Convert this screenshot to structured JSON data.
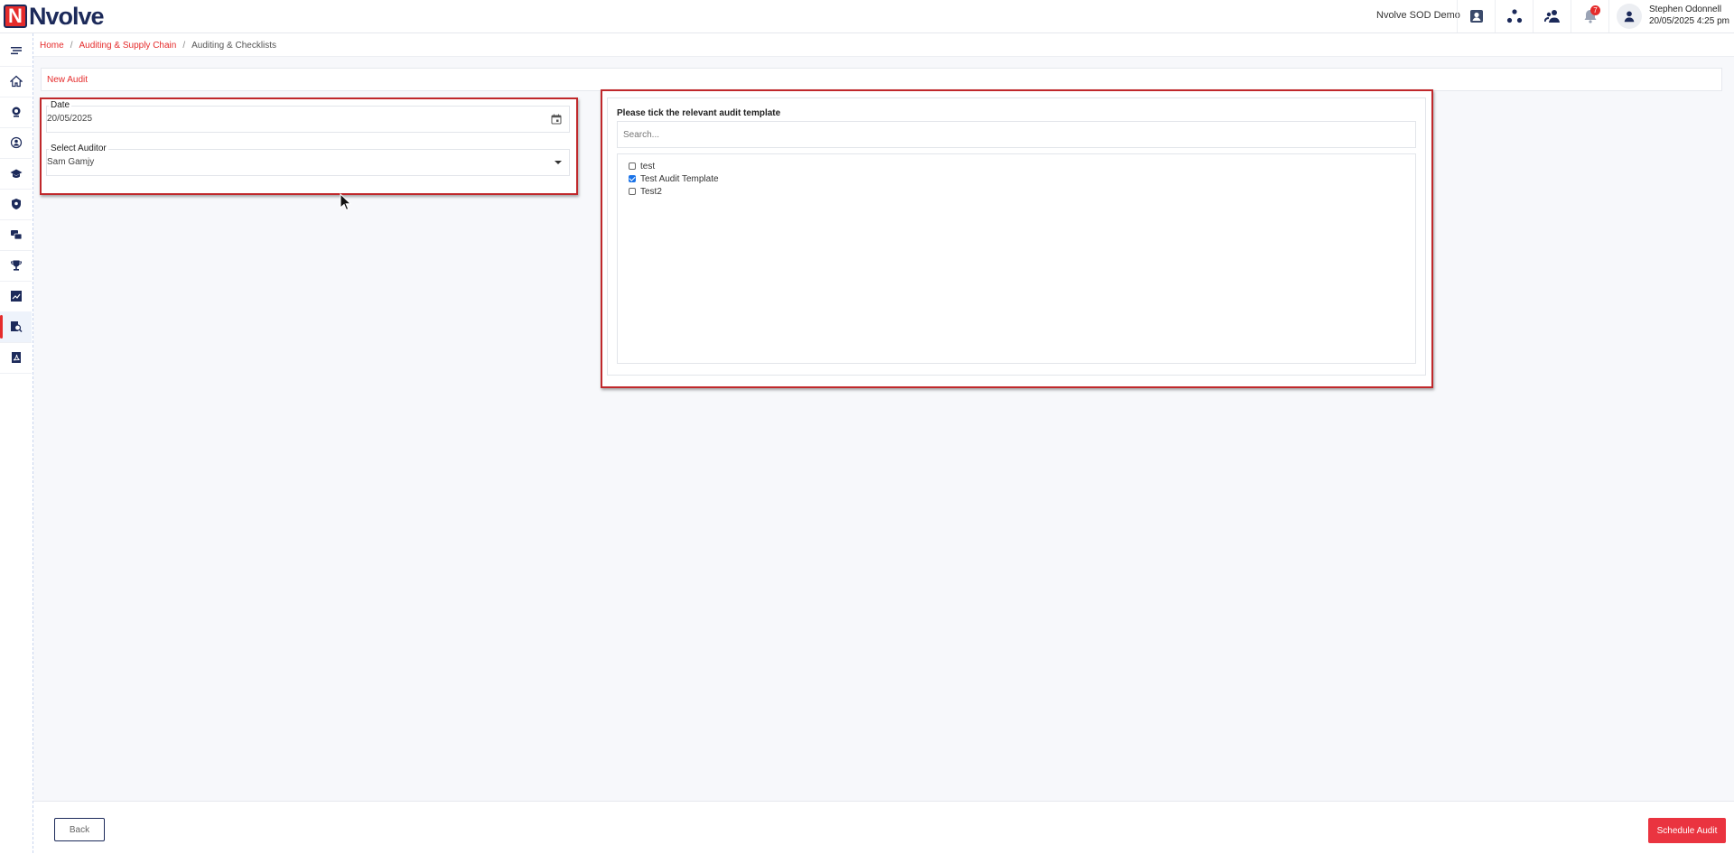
{
  "header": {
    "logo_letter": "N",
    "logo_text": "Nvolve",
    "org_name": "Nvolve SOD Demo",
    "notification_count": "7",
    "user_name": "Stephen Odonnell",
    "user_datetime": "20/05/2025 4:25 pm",
    "icons": [
      "contact-card-icon",
      "network-icon",
      "users-icon",
      "bell-icon",
      "user-avatar-icon"
    ]
  },
  "sidebar": {
    "items": [
      {
        "icon": "menu-toggle-icon"
      },
      {
        "icon": "home-icon"
      },
      {
        "icon": "camera-icon"
      },
      {
        "icon": "user-circle-icon"
      },
      {
        "icon": "graduation-cap-icon"
      },
      {
        "icon": "shield-icon"
      },
      {
        "icon": "chat-icon"
      },
      {
        "icon": "trophy-icon"
      },
      {
        "icon": "chart-icon"
      },
      {
        "icon": "search-document-icon",
        "active": true
      },
      {
        "icon": "pdf-icon"
      }
    ]
  },
  "breadcrumb": {
    "home": "Home",
    "section": "Auditing & Supply Chain",
    "current": "Auditing & Checklists",
    "separator": "/"
  },
  "page": {
    "title": "New Audit"
  },
  "form": {
    "date_label": "Date",
    "date_value": "20/05/2025",
    "auditor_label": "Select Auditor",
    "auditor_value": "Sam Gamjy"
  },
  "templates": {
    "title": "Please tick the relevant audit template",
    "search_placeholder": "Search...",
    "items": [
      {
        "label": "test",
        "checked": false
      },
      {
        "label": "Test Audit Template",
        "checked": true
      },
      {
        "label": "Test2",
        "checked": false
      }
    ]
  },
  "footer": {
    "back_label": "Back",
    "schedule_label": "Schedule Audit"
  },
  "colors": {
    "brand_red": "#e52b2b",
    "brand_navy": "#1c2a5a",
    "checkbox_blue": "#1a73e8"
  }
}
